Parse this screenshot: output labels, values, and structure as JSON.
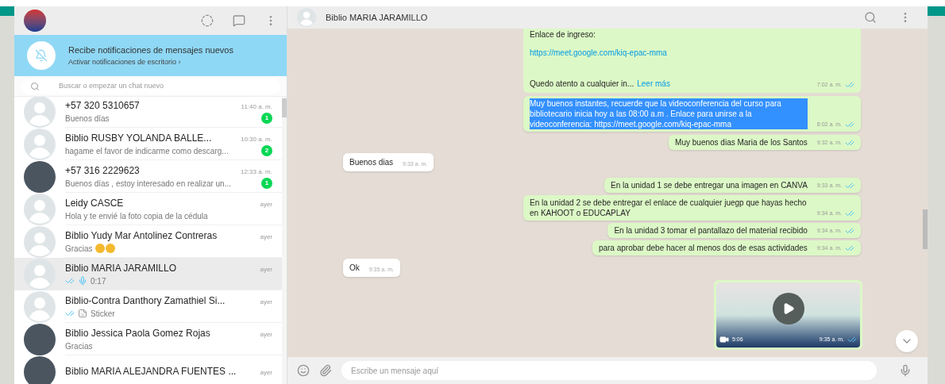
{
  "sidebar": {
    "notification": {
      "title": "Recibe notificaciones de mensajes nuevos",
      "action": "Activar notificaciones de escritorio ›"
    },
    "search": {
      "placeholder": "Buscar o empezar un chat nuevo"
    },
    "chats": [
      {
        "name": "+57 320 5310657",
        "time": "11:40 a. m.",
        "preview": "Buenos días",
        "unread": "1",
        "has_photo": false,
        "selected": false
      },
      {
        "name": "Biblio RUSBY YOLANDA BALLE...",
        "time": "10:30 a. m.",
        "preview": "hagame el favor de indicarme como descarg...",
        "unread": "2",
        "has_photo": false,
        "selected": false
      },
      {
        "name": "+57 316 2229623",
        "time": "12:33 a. m.",
        "preview": "Buenos días , estoy interesado en realizar un...",
        "unread": "1",
        "has_photo": true,
        "selected": false
      },
      {
        "name": "Leidy CASCE",
        "time": "ayer",
        "preview": "Hola y te envié la foto copia de la cédula",
        "has_photo": false,
        "selected": false
      },
      {
        "name": "Biblio Yudy Mar Antolinez Contreras",
        "time": "ayer",
        "preview": "Gracias",
        "has_photo": false,
        "selected": false,
        "emoji": true
      },
      {
        "name": "Biblio MARIA JARAMILLO",
        "time": "ayer",
        "preview": "0:17",
        "has_photo": false,
        "selected": true,
        "ticks": true,
        "voice": true
      },
      {
        "name": "Biblio-Contra Danthory Zamathiel Si...",
        "time": "ayer",
        "preview": "Sticker",
        "has_photo": false,
        "selected": false,
        "ticks": true,
        "sticker": true
      },
      {
        "name": "Biblio Jessica Paola Gomez Rojas",
        "time": "ayer",
        "preview": "Gracias",
        "has_photo": true,
        "selected": false
      },
      {
        "name": "Biblio MARIA ALEJANDRA FUENTES ...",
        "time": "ayer",
        "has_photo": true,
        "selected": false
      }
    ]
  },
  "conversation": {
    "title": "Biblio MARIA JARAMILLO",
    "messages": [
      {
        "kind": "long",
        "blocks": [
          {
            "kind": "text",
            "text": "Enlace de ingreso:"
          },
          {
            "kind": "link",
            "text": "https://meet.google.com/kiq-epac-mma"
          },
          {
            "kind": "text",
            "text": "Quedo atento a cualquier in...",
            "more": "Leer más"
          }
        ],
        "time": "7:02 a. m.",
        "ticks": true
      },
      {
        "kind": "out",
        "text": "Muy buenos instantes, recuerde que la videoconferencia del curso para bibliotecario inicia hoy a las 08:00 a.m . Enlace para unirse a la videoconferencia: https://meet.google.com/kiq-epac-mma",
        "time": "8:02 a. m.",
        "ticks": true,
        "highlighted": true
      },
      {
        "kind": "out",
        "text": "Muy buenos dias Maria de los Santos",
        "time": "9:32 a. m.",
        "ticks": true,
        "highlighted": false
      },
      {
        "kind": "in",
        "text": "Buenos dias",
        "time": "9:33 a. m."
      },
      {
        "kind": "out",
        "text": "En la unidad 1 se debe entregar una imagen en CANVA",
        "time": "9:33 a. m.",
        "ticks": true,
        "highlighted": false
      },
      {
        "kind": "out",
        "text": "En la unidad 2 se debe entregar el enlace de cualquier juegp que hayas hecho en KAHOOT o EDUCAPLAY",
        "time": "9:34 a. m.",
        "ticks": true,
        "highlighted": false
      },
      {
        "kind": "out",
        "text": "En la unidad 3 tomar el pantallazo del material recibido",
        "time": "9:34 a. m.",
        "ticks": true,
        "highlighted": false
      },
      {
        "kind": "out",
        "text": "para aprobar debe hacer al menos dos de esas actividades",
        "time": "9:34 a. m.",
        "ticks": true,
        "highlighted": false
      },
      {
        "kind": "in",
        "text": "Ok",
        "time": "9:35 a. m."
      },
      {
        "kind": "video",
        "duration": "5:06",
        "time": "9:35 a. m.",
        "ticks": true
      }
    ],
    "compose": {
      "placeholder": "Escribe un mensaje aquí"
    }
  }
}
